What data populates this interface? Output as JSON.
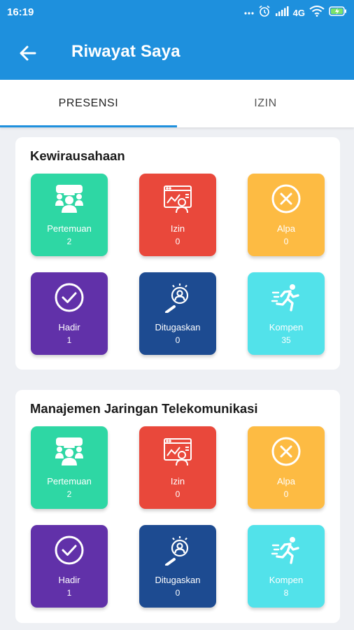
{
  "status_bar": {
    "time": "16:19",
    "network": "4G"
  },
  "app_bar": {
    "title": "Riwayat Saya"
  },
  "tabs": [
    {
      "label": "PRESENSI",
      "active": true
    },
    {
      "label": "IZIN",
      "active": false
    }
  ],
  "courses": [
    {
      "name": "Kewirausahaan",
      "stats": [
        {
          "label": "Pertemuan",
          "value": "2",
          "icon": "people-meeting-icon",
          "color": "#2ed7a4"
        },
        {
          "label": "Izin",
          "value": "0",
          "icon": "permission-document-icon",
          "color": "#e9483b"
        },
        {
          "label": "Alpa",
          "value": "0",
          "icon": "x-circle-icon",
          "color": "#fdbb43"
        },
        {
          "label": "Hadir",
          "value": "1",
          "icon": "check-circle-icon",
          "color": "#6131a9"
        },
        {
          "label": "Ditugaskan",
          "value": "0",
          "icon": "search-person-icon",
          "color": "#1d4b91"
        },
        {
          "label": "Kompen",
          "value": "35",
          "icon": "running-person-icon",
          "color": "#52e2ea"
        }
      ]
    },
    {
      "name": "Manajemen Jaringan Telekomunikasi",
      "stats": [
        {
          "label": "Pertemuan",
          "value": "2",
          "icon": "people-meeting-icon",
          "color": "#2ed7a4"
        },
        {
          "label": "Izin",
          "value": "0",
          "icon": "permission-document-icon",
          "color": "#e9483b"
        },
        {
          "label": "Alpa",
          "value": "0",
          "icon": "x-circle-icon",
          "color": "#fdbb43"
        },
        {
          "label": "Hadir",
          "value": "1",
          "icon": "check-circle-icon",
          "color": "#6131a9"
        },
        {
          "label": "Ditugaskan",
          "value": "0",
          "icon": "search-person-icon",
          "color": "#1d4b91"
        },
        {
          "label": "Kompen",
          "value": "8",
          "icon": "running-person-icon",
          "color": "#52e2ea"
        }
      ]
    }
  ],
  "theme": {
    "primary": "#1e90dd",
    "background": "#eef0f4"
  }
}
